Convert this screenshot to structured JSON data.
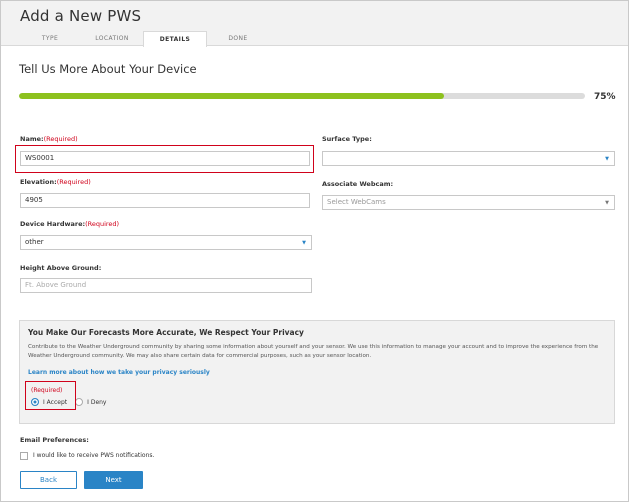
{
  "header": {
    "title": "Add a New PWS",
    "tabs": [
      {
        "label": "TYPE",
        "active": false
      },
      {
        "label": "LOCATION",
        "active": false
      },
      {
        "label": "DETAILS",
        "active": true
      },
      {
        "label": "DONE",
        "active": false
      }
    ]
  },
  "section_title": "Tell Us More About Your Device",
  "progress": {
    "fraction": 0.75,
    "label": "75%"
  },
  "form": {
    "name": {
      "label": "Name:",
      "required": "(Required)",
      "value": "WS0001"
    },
    "elevation": {
      "label": "Elevation:",
      "required": "(Required)",
      "value": "4905"
    },
    "device_hardware": {
      "label": "Device Hardware:",
      "required": "(Required)",
      "value": "other"
    },
    "height_above_ground": {
      "label": "Height Above Ground:",
      "placeholder": "Ft. Above Ground"
    },
    "surface_type": {
      "label": "Surface Type:",
      "value": ""
    },
    "associate_webcam": {
      "label": "Associate Webcam:",
      "placeholder": "Select WebCams"
    }
  },
  "privacy": {
    "title": "You Make Our Forecasts More Accurate, We Respect Your Privacy",
    "body": "Contribute to the Weather Underground community by sharing some information about yourself and your sensor. We use this information to manage your account and to improve the experience from the Weather Underground community. We may also share certain data for commercial purposes, such as your sensor location.",
    "learn_more": "Learn more about how we take your privacy seriously",
    "required": "(Required)",
    "accept_label": "I Accept",
    "deny_label": "I Deny",
    "selected": "accept"
  },
  "email": {
    "label": "Email Preferences:",
    "checkbox_label": "I would like to receive PWS notifications."
  },
  "buttons": {
    "back": "Back",
    "next": "Next"
  },
  "colors": {
    "accent": "#2a84c6",
    "progress": "#8dc11e",
    "required": "#d0021b"
  }
}
